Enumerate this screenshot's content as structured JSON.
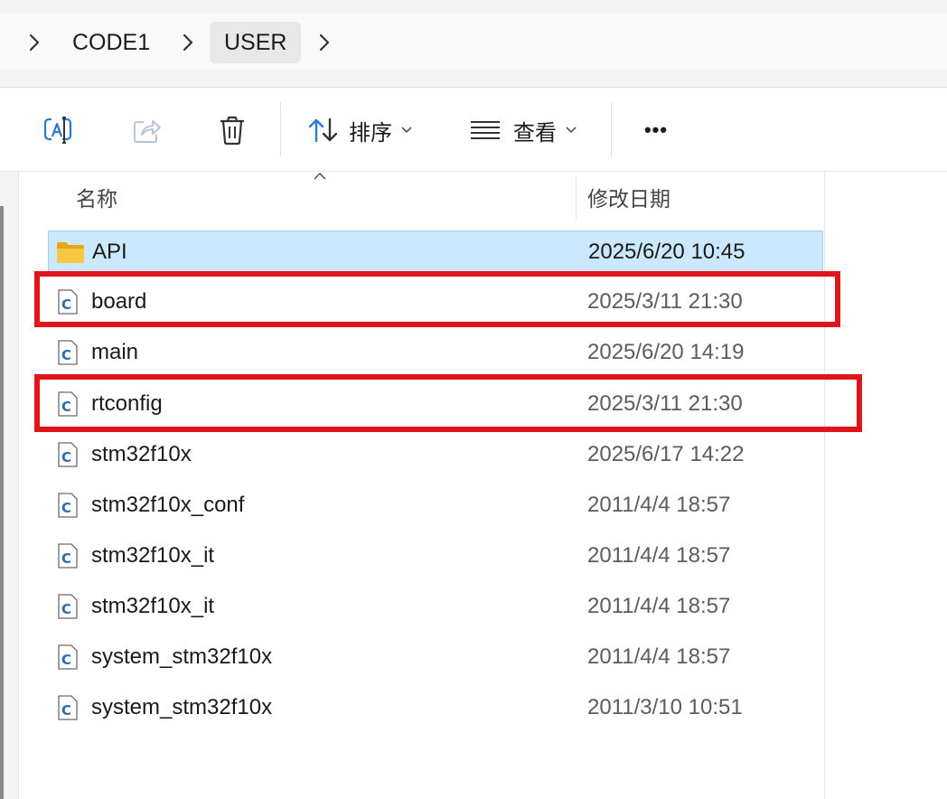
{
  "breadcrumb": {
    "items": [
      "CODE1",
      "USER"
    ]
  },
  "toolbar": {
    "sort_label": "排序",
    "view_label": "查看",
    "more_label": "•••"
  },
  "columns": {
    "name": "名称",
    "date": "修改日期"
  },
  "files": [
    {
      "name": "API",
      "date": "2025/6/20 10:45",
      "type": "folder",
      "selected": true
    },
    {
      "name": "board",
      "date": "2025/3/11 21:30",
      "type": "c-file",
      "highlighted": true
    },
    {
      "name": "main",
      "date": "2025/6/20 14:19",
      "type": "c-file"
    },
    {
      "name": "rtconfig",
      "date": "2025/3/11 21:30",
      "type": "c-file",
      "highlighted": true
    },
    {
      "name": "stm32f10x",
      "date": "2025/6/17 14:22",
      "type": "c-file"
    },
    {
      "name": "stm32f10x_conf",
      "date": "2011/4/4 18:57",
      "type": "c-file"
    },
    {
      "name": "stm32f10x_it",
      "date": "2011/4/4 18:57",
      "type": "c-file"
    },
    {
      "name": "stm32f10x_it",
      "date": "2011/4/4 18:57",
      "type": "c-file"
    },
    {
      "name": "system_stm32f10x",
      "date": "2011/4/4 18:57",
      "type": "c-file"
    },
    {
      "name": "system_stm32f10x",
      "date": "2011/3/10 10:51",
      "type": "c-file"
    }
  ],
  "colors": {
    "selection": "#cce8ff",
    "highlight_box": "#e0141a",
    "folder": "#f8c743"
  }
}
